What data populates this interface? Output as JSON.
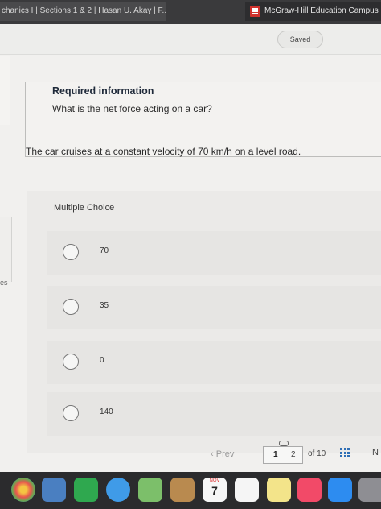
{
  "browser": {
    "left_tab_title": "chanics I | Sections 1 & 2 | Hasan U. Akay | F...",
    "right_tab_title": "McGraw-Hill Education Campus"
  },
  "header": {
    "saved_label": "Saved"
  },
  "info": {
    "title": "Required information",
    "question": "What is the net force acting on a car?"
  },
  "problem": {
    "text": "The car cruises at a constant velocity of 70 km/h on a level road."
  },
  "multiple_choice": {
    "label": "Multiple Choice",
    "options": [
      {
        "label": "70"
      },
      {
        "label": "35"
      },
      {
        "label": "0"
      },
      {
        "label": "140"
      }
    ]
  },
  "left_edge": {
    "peek_text": "es"
  },
  "nav": {
    "prev_label": "Prev",
    "current_page": "1",
    "next_page": "2",
    "of_label": "of 10",
    "next_peek": "N"
  },
  "dock": {
    "calendar_month": "NOV",
    "calendar_day": "7",
    "icons": [
      "photos-icon",
      "preview-icon",
      "facetime-icon",
      "messages-icon",
      "maps-icon",
      "contacts-icon",
      "calendar-icon",
      "reminders-icon",
      "notes-icon",
      "music-icon",
      "appstore-icon",
      "settings-icon"
    ]
  },
  "colors": {
    "accent_blue": "#2f6fb5",
    "mh_red": "#d0312d"
  }
}
